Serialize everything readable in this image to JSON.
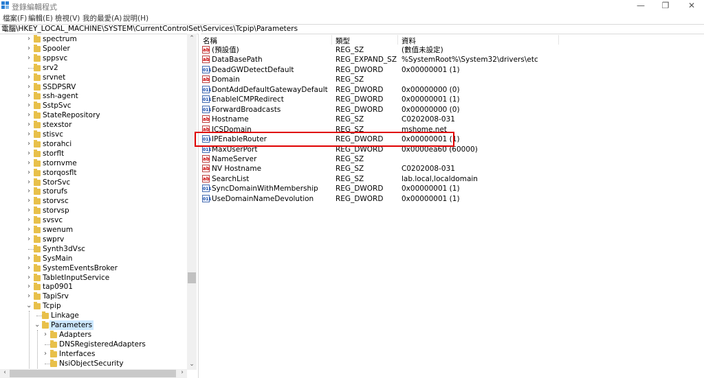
{
  "window": {
    "title": "登錄編輯程式",
    "minimize": "—",
    "maximize": "❐",
    "close": "✕"
  },
  "menu": [
    "檔案(F)",
    "編輯(E)",
    "檢視(V)",
    "我的最愛(A)",
    "說明(H)"
  ],
  "address": "電腦\\HKEY_LOCAL_MACHINE\\SYSTEM\\CurrentControlSet\\Services\\Tcpip\\Parameters",
  "tree": [
    {
      "label": "spectrum",
      "level": 0,
      "expander": "collapsed"
    },
    {
      "label": "Spooler",
      "level": 0,
      "expander": "collapsed"
    },
    {
      "label": "sppsvc",
      "level": 0,
      "expander": "collapsed"
    },
    {
      "label": "srv2",
      "level": 0,
      "expander": "none"
    },
    {
      "label": "srvnet",
      "level": 0,
      "expander": "collapsed"
    },
    {
      "label": "SSDPSRV",
      "level": 0,
      "expander": "collapsed"
    },
    {
      "label": "ssh-agent",
      "level": 0,
      "expander": "collapsed"
    },
    {
      "label": "SstpSvc",
      "level": 0,
      "expander": "collapsed"
    },
    {
      "label": "StateRepository",
      "level": 0,
      "expander": "collapsed"
    },
    {
      "label": "stexstor",
      "level": 0,
      "expander": "collapsed"
    },
    {
      "label": "stisvc",
      "level": 0,
      "expander": "collapsed"
    },
    {
      "label": "storahci",
      "level": 0,
      "expander": "collapsed"
    },
    {
      "label": "storflt",
      "level": 0,
      "expander": "collapsed"
    },
    {
      "label": "stornvme",
      "level": 0,
      "expander": "collapsed"
    },
    {
      "label": "storqosflt",
      "level": 0,
      "expander": "collapsed"
    },
    {
      "label": "StorSvc",
      "level": 0,
      "expander": "collapsed"
    },
    {
      "label": "storufs",
      "level": 0,
      "expander": "collapsed"
    },
    {
      "label": "storvsc",
      "level": 0,
      "expander": "collapsed"
    },
    {
      "label": "storvsp",
      "level": 0,
      "expander": "collapsed"
    },
    {
      "label": "svsvc",
      "level": 0,
      "expander": "collapsed"
    },
    {
      "label": "swenum",
      "level": 0,
      "expander": "collapsed"
    },
    {
      "label": "swprv",
      "level": 0,
      "expander": "collapsed"
    },
    {
      "label": "Synth3dVsc",
      "level": 0,
      "expander": "none"
    },
    {
      "label": "SysMain",
      "level": 0,
      "expander": "collapsed"
    },
    {
      "label": "SystemEventsBroker",
      "level": 0,
      "expander": "collapsed"
    },
    {
      "label": "TabletInputService",
      "level": 0,
      "expander": "collapsed"
    },
    {
      "label": "tap0901",
      "level": 0,
      "expander": "collapsed"
    },
    {
      "label": "TapiSrv",
      "level": 0,
      "expander": "collapsed"
    },
    {
      "label": "Tcpip",
      "level": 0,
      "expander": "expanded"
    },
    {
      "label": "Linkage",
      "level": 1,
      "expander": "none"
    },
    {
      "label": "Parameters",
      "level": 1,
      "expander": "expanded",
      "selected": true
    },
    {
      "label": "Adapters",
      "level": 2,
      "expander": "collapsed"
    },
    {
      "label": "DNSRegisteredAdapters",
      "level": 2,
      "expander": "none"
    },
    {
      "label": "Interfaces",
      "level": 2,
      "expander": "collapsed"
    },
    {
      "label": "NsiObjectSecurity",
      "level": 2,
      "expander": "none"
    }
  ],
  "columns": {
    "name": "名稱",
    "type": "類型",
    "data": "資料"
  },
  "values": [
    {
      "name": "(預設值)",
      "type": "REG_SZ",
      "data": "(數值未設定)",
      "icon": "sz"
    },
    {
      "name": "DataBasePath",
      "type": "REG_EXPAND_SZ",
      "data": "%SystemRoot%\\System32\\drivers\\etc",
      "icon": "sz"
    },
    {
      "name": "DeadGWDetectDefault",
      "type": "REG_DWORD",
      "data": "0x00000001 (1)",
      "icon": "dw"
    },
    {
      "name": "Domain",
      "type": "REG_SZ",
      "data": "",
      "icon": "sz"
    },
    {
      "name": "DontAddDefaultGatewayDefault",
      "type": "REG_DWORD",
      "data": "0x00000000 (0)",
      "icon": "dw"
    },
    {
      "name": "EnableICMPRedirect",
      "type": "REG_DWORD",
      "data": "0x00000001 (1)",
      "icon": "dw"
    },
    {
      "name": "ForwardBroadcasts",
      "type": "REG_DWORD",
      "data": "0x00000000 (0)",
      "icon": "dw"
    },
    {
      "name": "Hostname",
      "type": "REG_SZ",
      "data": "C0202008-031",
      "icon": "sz"
    },
    {
      "name": "ICSDomain",
      "type": "REG_SZ",
      "data": "mshome.net",
      "icon": "sz"
    },
    {
      "name": "IPEnableRouter",
      "type": "REG_DWORD",
      "data": "0x00000001 (1)",
      "icon": "dw"
    },
    {
      "name": "MaxUserPort",
      "type": "REG_DWORD",
      "data": "0x0000ea60 (60000)",
      "icon": "dw"
    },
    {
      "name": "NameServer",
      "type": "REG_SZ",
      "data": "",
      "icon": "sz"
    },
    {
      "name": "NV Hostname",
      "type": "REG_SZ",
      "data": "C0202008-031",
      "icon": "sz"
    },
    {
      "name": "SearchList",
      "type": "REG_SZ",
      "data": "lab.local,localdomain",
      "icon": "sz"
    },
    {
      "name": "SyncDomainWithMembership",
      "type": "REG_DWORD",
      "data": "0x00000001 (1)",
      "icon": "dw"
    },
    {
      "name": "UseDomainNameDevolution",
      "type": "REG_DWORD",
      "data": "0x00000001 (1)",
      "icon": "dw"
    }
  ],
  "icon_text": {
    "sz": "ab",
    "dw": "011"
  },
  "colors": {
    "highlight": "#e00000",
    "selection": "#cce8ff",
    "folder": "#e8c04a"
  }
}
